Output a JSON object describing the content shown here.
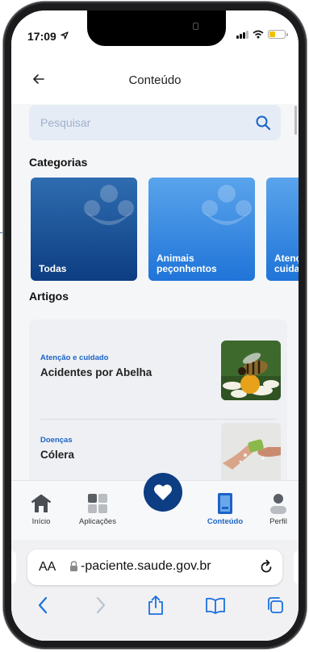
{
  "status": {
    "time": "17:09"
  },
  "header": {
    "title": "Conteúdo"
  },
  "search": {
    "placeholder": "Pesquisar"
  },
  "categories": {
    "heading": "Categorias",
    "items": [
      {
        "label": "Todas"
      },
      {
        "label": "Animais\npeçonhentos"
      },
      {
        "label": "Atenç\ncuidad"
      }
    ]
  },
  "articles": {
    "heading": "Artigos",
    "items": [
      {
        "category": "Atenção e cuidado",
        "title": "Acidentes por Abelha"
      },
      {
        "category": "Doenças",
        "title": "Cólera"
      }
    ]
  },
  "tabs": [
    {
      "label": "Início",
      "icon": "house-icon"
    },
    {
      "label": "Aplicações",
      "icon": "grid-icon"
    },
    {
      "label": "Conteúdo",
      "icon": "book-icon",
      "active": true
    },
    {
      "label": "Perfil",
      "icon": "person-icon"
    }
  ],
  "browser": {
    "aa": "AA",
    "url": "-paciente.saude.gov.br"
  },
  "colors": {
    "primary": "#0d3d82",
    "accent": "#1b63c6",
    "search_bg": "#e5ecf6"
  }
}
